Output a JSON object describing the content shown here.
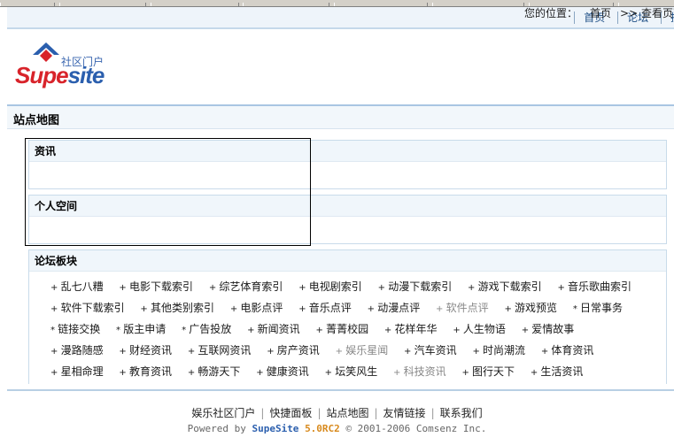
{
  "topnav": {
    "items": [
      "首页",
      "论坛",
      "搜索"
    ]
  },
  "logo": {
    "tagline": "社区门户",
    "word_part1": "Supe",
    "word_part2": "site"
  },
  "section": {
    "title": "站点地图"
  },
  "breadcrumb": {
    "prefix": "您的位置：",
    "home": "首页",
    "current": ">> 查看页面"
  },
  "panels": {
    "news": {
      "title": "资讯"
    },
    "personal": {
      "title": "个人空间"
    },
    "forums": {
      "title": "论坛板块"
    }
  },
  "forum_rows": [
    [
      "乱七八糟",
      "电影下载索引",
      "综艺体育索引",
      "电视剧索引",
      "动漫下载索引",
      "游戏下载索引",
      "音乐歌曲索引"
    ],
    [
      "软件下载索引",
      "其他类别索引",
      "电影点评",
      "音乐点评",
      "动漫点评",
      "软件点评",
      "游戏预览",
      "日常事务"
    ],
    [
      "链接交换",
      "版主申请",
      "广告投放",
      "新闻资讯",
      "菁菁校园",
      "花样年华",
      "人生物语",
      "爱情故事"
    ],
    [
      "漫路随感",
      "财经资讯",
      "互联网资讯",
      "房产资讯",
      "娱乐星闻",
      "汽车资讯",
      "时尚潮流",
      "体育资讯"
    ],
    [
      "星相命理",
      "教育资讯",
      "畅游天下",
      "健康资讯",
      "坛笑风生",
      "科技资讯",
      "图行天下",
      "生活资讯"
    ]
  ],
  "footer": {
    "links": [
      "娱乐社区门户",
      "快捷面板",
      "站点地图",
      "友情链接",
      "联系我们"
    ],
    "powered_prefix": "Powered by",
    "powered_brand": "SupeSite",
    "powered_version": "5.0RC2",
    "powered_suffix": "© 2001-2006 Comsenz Inc."
  },
  "colors": {
    "accent_blue": "#2b5fae",
    "logo_red": "#d8232a",
    "bar_bg": "#eef4fa"
  }
}
